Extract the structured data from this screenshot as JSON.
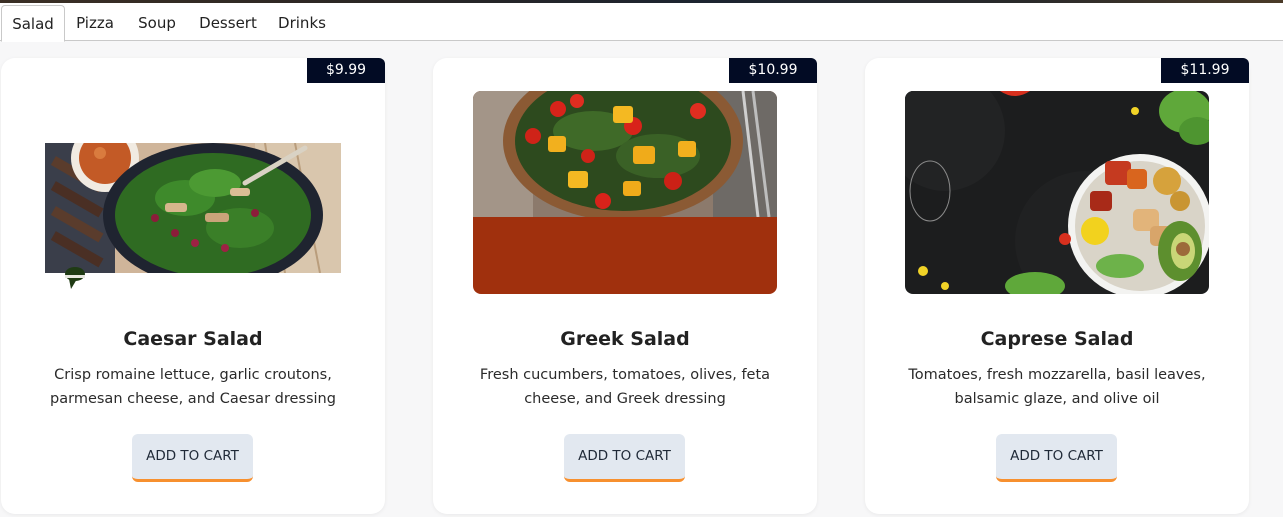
{
  "tabs": [
    {
      "label": "Salad",
      "active": true
    },
    {
      "label": "Pizza",
      "active": false
    },
    {
      "label": "Soup",
      "active": false
    },
    {
      "label": "Dessert",
      "active": false
    },
    {
      "label": "Drinks",
      "active": false
    }
  ],
  "colors": {
    "price_tag_bg": "#020b24",
    "button_bg": "#e2e8f0",
    "button_accent": "#f7902f",
    "greek_image_bg": "#a0300d"
  },
  "cards": [
    {
      "price": "$9.99",
      "title": "Caesar Salad",
      "description": "Crisp romaine lettuce, garlic croutons, parmesan cheese, and Caesar dressing",
      "button": "ADD TO CART",
      "image": "spinach-salad-bowl-photo"
    },
    {
      "price": "$10.99",
      "title": "Greek Salad",
      "description": "Fresh cucumbers, tomatoes, olives, feta cheese, and Greek dressing",
      "button": "ADD TO CART",
      "image": "tomato-mango-salad-bowl-photo"
    },
    {
      "price": "$11.99",
      "title": "Caprese Salad",
      "description": "Tomatoes, fresh mozzarella, basil leaves, balsamic glaze, and olive oil",
      "button": "ADD TO CART",
      "image": "vegetable-bowl-dark-board-photo"
    }
  ]
}
